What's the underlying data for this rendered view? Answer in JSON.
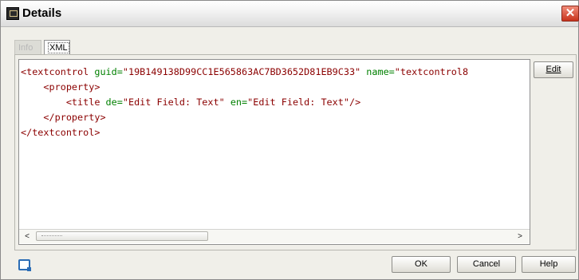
{
  "window": {
    "title": "Details",
    "close_symbol": "✕"
  },
  "tabs": [
    {
      "label": "Info",
      "active": false
    },
    {
      "label": "XML",
      "active": true
    }
  ],
  "editor": {
    "lines": [
      {
        "indent": "",
        "parts": [
          {
            "type": "tag",
            "text": "<textcontrol "
          },
          {
            "type": "attr",
            "text": "guid="
          },
          {
            "type": "val",
            "text": "\"19B149138D99CC1E565863AC7BD3652D81EB9C33\" "
          },
          {
            "type": "attr",
            "text": "name="
          },
          {
            "type": "val",
            "text": "\"textcontrol8"
          }
        ]
      },
      {
        "indent": "    ",
        "parts": [
          {
            "type": "tag",
            "text": "<property>"
          }
        ]
      },
      {
        "indent": "        ",
        "parts": [
          {
            "type": "tag",
            "text": "<title "
          },
          {
            "type": "attr",
            "text": "de="
          },
          {
            "type": "val",
            "text": "\"Edit Field: Text\" "
          },
          {
            "type": "attr",
            "text": "en="
          },
          {
            "type": "val",
            "text": "\"Edit Field: Text\""
          },
          {
            "type": "tag",
            "text": "/>"
          }
        ]
      },
      {
        "indent": "    ",
        "parts": [
          {
            "type": "tag",
            "text": "</property>"
          }
        ]
      },
      {
        "indent": "",
        "parts": [
          {
            "type": "tag",
            "text": "</textcontrol>"
          }
        ]
      }
    ]
  },
  "scrollbar": {
    "left_arrow": "<",
    "right_arrow": ">"
  },
  "buttons": {
    "edit": "Edit",
    "ok": "OK",
    "cancel": "Cancel",
    "help": "Help"
  },
  "icons": {
    "app": "app-window-icon",
    "footer": "help-document-icon"
  },
  "colors": {
    "tag": "#8b0000",
    "attribute": "#008000",
    "value": "#8b0000",
    "close_button": "#c8331b"
  }
}
